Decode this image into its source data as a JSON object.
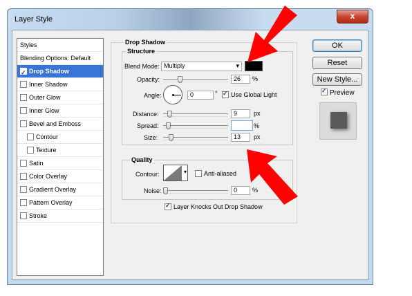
{
  "window": {
    "title": "Layer Style",
    "close_label": "x"
  },
  "styles_panel": {
    "header": "Styles",
    "items": [
      {
        "label": "Blending Options: Default",
        "check": false,
        "checked": false,
        "selected": false,
        "indent": 0
      },
      {
        "label": "Drop Shadow",
        "check": true,
        "checked": true,
        "selected": true,
        "indent": 0
      },
      {
        "label": "Inner Shadow",
        "check": true,
        "checked": false,
        "selected": false,
        "indent": 0
      },
      {
        "label": "Outer Glow",
        "check": true,
        "checked": false,
        "selected": false,
        "indent": 0
      },
      {
        "label": "Inner Glow",
        "check": true,
        "checked": false,
        "selected": false,
        "indent": 0
      },
      {
        "label": "Bevel and Emboss",
        "check": true,
        "checked": false,
        "selected": false,
        "indent": 0
      },
      {
        "label": "Contour",
        "check": true,
        "checked": false,
        "selected": false,
        "indent": 1
      },
      {
        "label": "Texture",
        "check": true,
        "checked": false,
        "selected": false,
        "indent": 1
      },
      {
        "label": "Satin",
        "check": true,
        "checked": false,
        "selected": false,
        "indent": 0
      },
      {
        "label": "Color Overlay",
        "check": true,
        "checked": false,
        "selected": false,
        "indent": 0
      },
      {
        "label": "Gradient Overlay",
        "check": true,
        "checked": false,
        "selected": false,
        "indent": 0
      },
      {
        "label": "Pattern Overlay",
        "check": true,
        "checked": false,
        "selected": false,
        "indent": 0
      },
      {
        "label": "Stroke",
        "check": true,
        "checked": false,
        "selected": false,
        "indent": 0
      }
    ]
  },
  "drop_shadow": {
    "title": "Drop Shadow",
    "structure": {
      "title": "Structure",
      "blend_mode_label": "Blend Mode:",
      "blend_mode_value": "Multiply",
      "shadow_color": "#000000",
      "opacity_label": "Opacity:",
      "opacity_value": "26",
      "opacity_unit": "%",
      "opacity_level": 0.26,
      "angle_label": "Angle:",
      "angle_value": "0",
      "angle_unit": "°",
      "use_global_light_label": "Use Global Light",
      "use_global_light": true,
      "distance_label": "Distance:",
      "distance_value": "9",
      "distance_unit": "px",
      "spread_label": "Spread:",
      "spread_value": "",
      "spread_unit": "%",
      "size_label": "Size:",
      "size_value": "13",
      "size_unit": "px"
    },
    "quality": {
      "title": "Quality",
      "contour_label": "Contour:",
      "anti_aliased_label": "Anti-aliased",
      "anti_aliased": false,
      "noise_label": "Noise:",
      "noise_value": "0",
      "noise_unit": "%"
    },
    "knocks_out_label": "Layer Knocks Out Drop Shadow",
    "knocks_out": true
  },
  "buttons": {
    "ok": "OK",
    "reset": "Reset",
    "new_style": "New Style...",
    "preview_label": "Preview",
    "preview_checked": true
  },
  "annotation_color": "#ff0000"
}
